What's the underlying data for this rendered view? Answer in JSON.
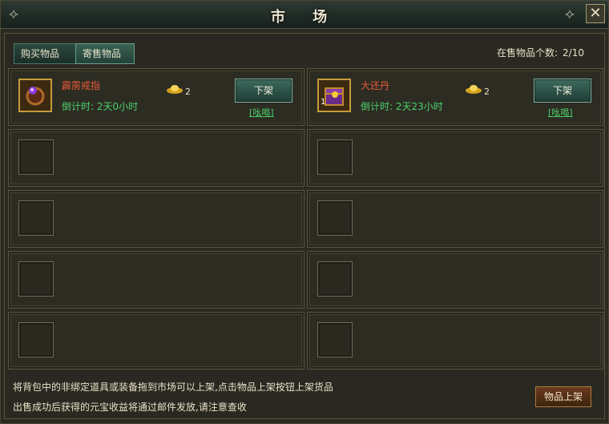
{
  "window": {
    "title": "市 场",
    "close_glyph": "✕"
  },
  "tabs": [
    {
      "label": "购买物品"
    },
    {
      "label": "寄售物品"
    }
  ],
  "stock": {
    "label": "在售物品个数:",
    "value": "2/10"
  },
  "listings": [
    {
      "name": "霹雳戒指",
      "price": "2",
      "timer": "倒计时: 2天0小时",
      "button": "下架",
      "link": "[吆喝]",
      "quantity": ""
    },
    {
      "name": "大还丹",
      "price": "2",
      "timer": "倒计时: 2天23小时",
      "button": "下架",
      "link": "[吆喝]",
      "quantity": "1"
    }
  ],
  "footer": {
    "line1": "将背包中的非绑定道具或装备拖到市场可以上架,点击物品上架按钮上架货品",
    "line2": "出售成功后获得的元宝收益将通过邮件发放,请注意查收",
    "list_button": "物品上架"
  },
  "colors": {
    "item_name": "#e85a3a",
    "timer": "#4bd06a",
    "accent": "#3d6a5d"
  },
  "icons": {
    "currency": "gold-ingot-icon",
    "item1": "ring-icon",
    "item2": "treasure-chest-icon"
  }
}
